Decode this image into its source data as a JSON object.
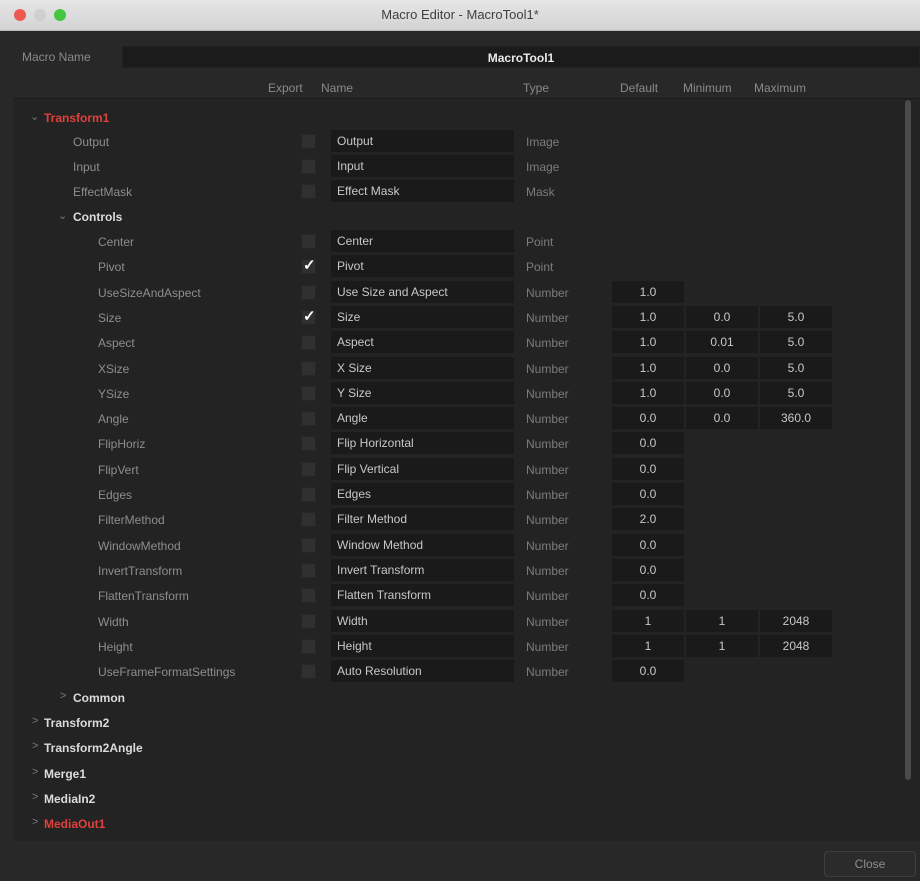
{
  "window": {
    "title": "Macro Editor - MacroTool1*"
  },
  "macro": {
    "name_label": "Macro Name",
    "name_value": "MacroTool1"
  },
  "columns": {
    "export": "Export",
    "name": "Name",
    "type": "Type",
    "default": "Default",
    "minimum": "Minimum",
    "maximum": "Maximum"
  },
  "tree": {
    "transform1": {
      "label": "Transform1"
    },
    "controls": {
      "label": "Controls"
    },
    "common": {
      "label": "Common"
    },
    "output": {
      "label": "Output",
      "name": "Output",
      "type": "Image",
      "checked": false
    },
    "input": {
      "label": "Input",
      "name": "Input",
      "type": "Image",
      "checked": false
    },
    "effectmask": {
      "label": "EffectMask",
      "name": "Effect Mask",
      "type": "Mask",
      "checked": false
    },
    "controls_rows": [
      {
        "label": "Center",
        "name": "Center",
        "type": "Point",
        "checked": false,
        "default": "",
        "min": "",
        "max": ""
      },
      {
        "label": "Pivot",
        "name": "Pivot",
        "type": "Point",
        "checked": true,
        "default": "",
        "min": "",
        "max": ""
      },
      {
        "label": "UseSizeAndAspect",
        "name": "Use Size and Aspect",
        "type": "Number",
        "checked": false,
        "default": "1.0",
        "min": "",
        "max": ""
      },
      {
        "label": "Size",
        "name": "Size",
        "type": "Number",
        "checked": true,
        "default": "1.0",
        "min": "0.0",
        "max": "5.0"
      },
      {
        "label": "Aspect",
        "name": "Aspect",
        "type": "Number",
        "checked": false,
        "default": "1.0",
        "min": "0.01",
        "max": "5.0"
      },
      {
        "label": "XSize",
        "name": "X Size",
        "type": "Number",
        "checked": false,
        "default": "1.0",
        "min": "0.0",
        "max": "5.0"
      },
      {
        "label": "YSize",
        "name": "Y Size",
        "type": "Number",
        "checked": false,
        "default": "1.0",
        "min": "0.0",
        "max": "5.0"
      },
      {
        "label": "Angle",
        "name": "Angle",
        "type": "Number",
        "checked": false,
        "default": "0.0",
        "min": "0.0",
        "max": "360.0"
      },
      {
        "label": "FlipHoriz",
        "name": "Flip Horizontal",
        "type": "Number",
        "checked": false,
        "default": "0.0",
        "min": "",
        "max": ""
      },
      {
        "label": "FlipVert",
        "name": "Flip Vertical",
        "type": "Number",
        "checked": false,
        "default": "0.0",
        "min": "",
        "max": ""
      },
      {
        "label": "Edges",
        "name": "Edges",
        "type": "Number",
        "checked": false,
        "default": "0.0",
        "min": "",
        "max": ""
      },
      {
        "label": "FilterMethod",
        "name": "Filter Method",
        "type": "Number",
        "checked": false,
        "default": "2.0",
        "min": "",
        "max": ""
      },
      {
        "label": "WindowMethod",
        "name": "Window Method",
        "type": "Number",
        "checked": false,
        "default": "0.0",
        "min": "",
        "max": ""
      },
      {
        "label": "InvertTransform",
        "name": "Invert Transform",
        "type": "Number",
        "checked": false,
        "default": "0.0",
        "min": "",
        "max": ""
      },
      {
        "label": "FlattenTransform",
        "name": "Flatten Transform",
        "type": "Number",
        "checked": false,
        "default": "0.0",
        "min": "",
        "max": ""
      },
      {
        "label": "Width",
        "name": "Width",
        "type": "Number",
        "checked": false,
        "default": "1",
        "min": "1",
        "max": "2048"
      },
      {
        "label": "Height",
        "name": "Height",
        "type": "Number",
        "checked": false,
        "default": "1",
        "min": "1",
        "max": "2048"
      },
      {
        "label": "UseFrameFormatSettings",
        "name": "Auto Resolution",
        "type": "Number",
        "checked": false,
        "default": "0.0",
        "min": "",
        "max": ""
      }
    ],
    "other_tools": [
      {
        "label": "Transform2",
        "highlight": false
      },
      {
        "label": "Transform2Angle",
        "highlight": false
      },
      {
        "label": "Merge1",
        "highlight": false
      },
      {
        "label": "MediaIn2",
        "highlight": false
      },
      {
        "label": "MediaOut1",
        "highlight": true
      }
    ]
  },
  "buttons": {
    "close": "Close"
  },
  "colors": {
    "accent_red": "#e0413a"
  }
}
